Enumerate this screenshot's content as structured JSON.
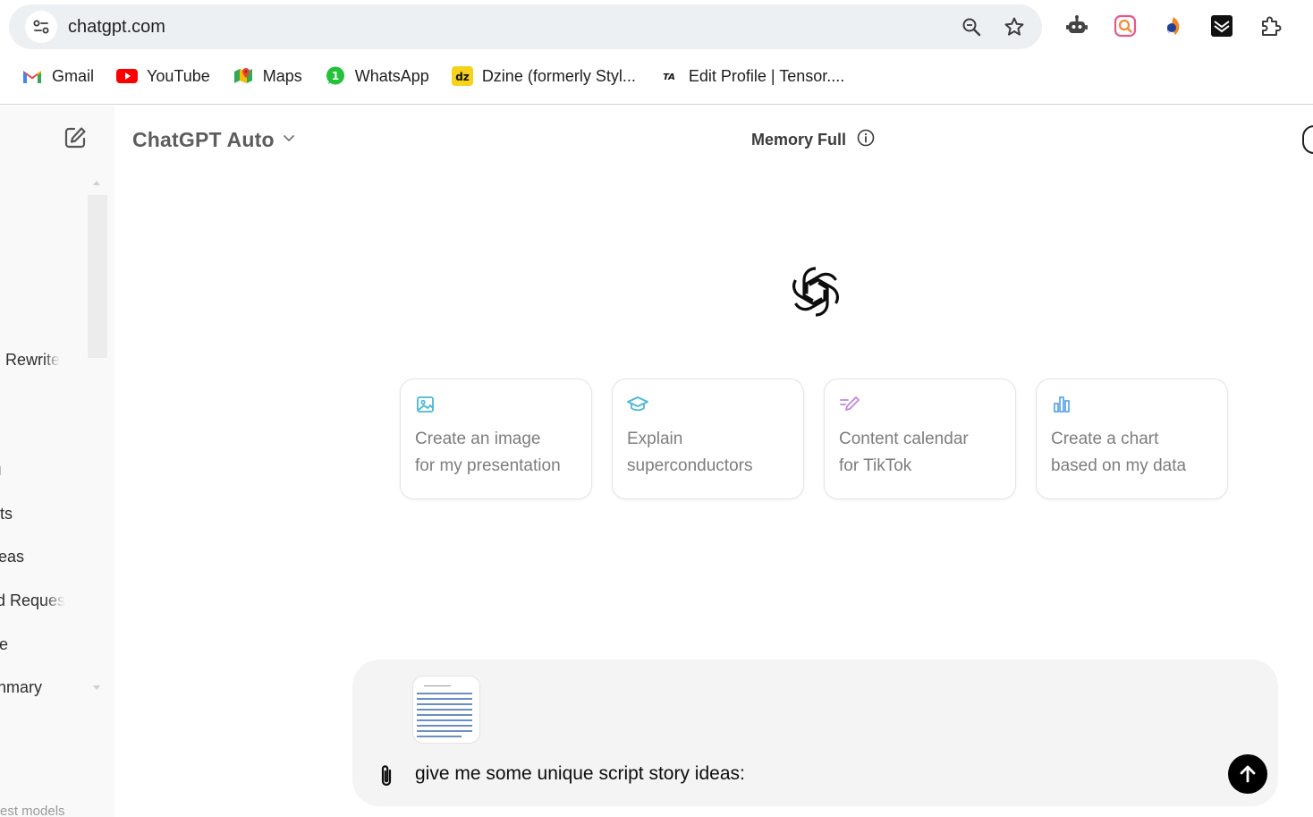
{
  "browser": {
    "url": "chatgpt.com",
    "bookmarks": [
      {
        "label": "Gmail",
        "icon": "gmail-icon"
      },
      {
        "label": "YouTube",
        "icon": "youtube-icon"
      },
      {
        "label": "Maps",
        "icon": "maps-icon"
      },
      {
        "label": "WhatsApp",
        "icon": "whatsapp-icon"
      },
      {
        "label": "Dzine (formerly Styl...",
        "icon": "dzine-icon",
        "badge": "dz"
      },
      {
        "label": "Edit Profile | Tensor....",
        "icon": "tensor-icon",
        "badge": "TA"
      }
    ],
    "extensions": [
      "robot-icon",
      "instagram-search-icon",
      "orange-blue-icon",
      "shield-badge-icon",
      "puzzle-icon"
    ]
  },
  "sidebar": {
    "items": [
      {
        "label": "Rewrite",
        "faded": true
      },
      {
        "label": "ı",
        "faded": false
      },
      {
        "label": "ts",
        "faded": false
      },
      {
        "label": "eas",
        "faded": false
      },
      {
        "label": "d Reques",
        "faded": true
      },
      {
        "label": "e",
        "faded": false
      },
      {
        "label": "nmary",
        "faded": false
      }
    ],
    "bottom_label": "est models"
  },
  "header": {
    "model": "ChatGPT Auto",
    "memory": "Memory Full"
  },
  "suggestions": [
    {
      "line1": "Create an image",
      "line2": "for my presentation",
      "icon": "image-icon",
      "color": "#35ae47"
    },
    {
      "line1": "Explain",
      "line2": "superconductors",
      "icon": "graduation-cap-icon",
      "color": "#4ab7d6"
    },
    {
      "line1": "Content calendar",
      "line2": "for TikTok",
      "icon": "pen-icon",
      "color": "#c285e0"
    },
    {
      "line1": "Create a chart",
      "line2": "based on my data",
      "icon": "chart-icon",
      "color": "#5aa4e8"
    }
  ],
  "composer": {
    "text": "give me some unique script story ideas:"
  },
  "colors": {
    "sidebar_bg": "#f9f9f9",
    "composer_bg": "#f4f4f4",
    "send_bg": "#000000"
  }
}
